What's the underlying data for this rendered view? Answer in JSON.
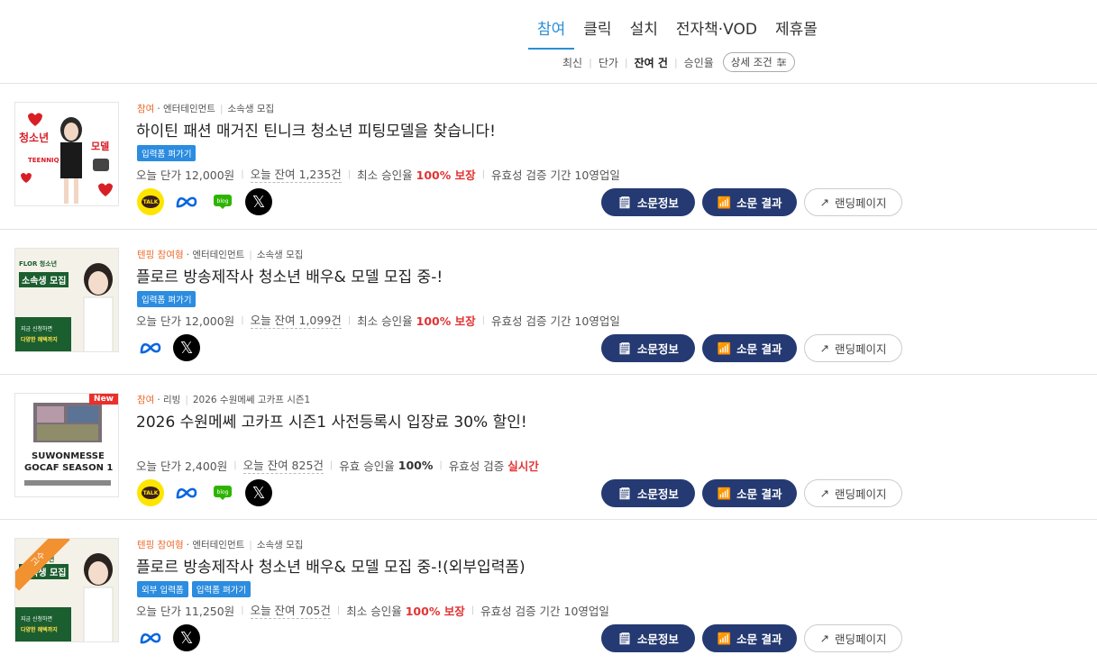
{
  "tabs": [
    {
      "label": "참여",
      "active": true
    },
    {
      "label": "클릭",
      "active": false
    },
    {
      "label": "설치",
      "active": false
    },
    {
      "label": "전자책·VOD",
      "active": false
    },
    {
      "label": "제휴몰",
      "active": false
    }
  ],
  "sorts": [
    {
      "label": "최신",
      "active": false
    },
    {
      "label": "단가",
      "active": false
    },
    {
      "label": "잔여 건",
      "active": true
    },
    {
      "label": "승인율",
      "active": false
    }
  ],
  "detail_filter_label": "상세 조건",
  "buttons": {
    "info": "소문정보",
    "result": "소문 결과",
    "landing": "랜딩페이지"
  },
  "colors": {
    "accent": "#2a8fd6",
    "navy": "#253a72",
    "highlight": "#e23434",
    "category": "#ec6a2a",
    "badge": "#2b8ce0"
  },
  "items": [
    {
      "meta": {
        "category": "참여",
        "sub": "· 엔터테인먼트",
        "tag": "소속생 모집"
      },
      "title": "하이틴 패션 매거진 틴니크 청소년 피팅모델을 찾습니다!",
      "badges": [
        "입력폼 펴가기"
      ],
      "price": "오늘 단가 12,000원",
      "remaining": "오늘 잔여 1,235건",
      "rate_label": "최소 승인율",
      "rate_value": "100% 보장",
      "valid": "유효성 검증 기간 10영업일",
      "socials": [
        "kakao-talk",
        "meta",
        "naver-blog",
        "x"
      ],
      "thumb_text": [
        "청소년",
        "모델",
        "TEENNIQ"
      ]
    },
    {
      "meta": {
        "category": "텐핑 참여형",
        "sub": "· 엔터테인먼트",
        "tag": "소속생 모집"
      },
      "title": "플로르 방송제작사 청소년 배우& 모델 모집 중-!",
      "badges": [
        "입력폼 펴가기"
      ],
      "price": "오늘 단가 12,000원",
      "remaining": "오늘 잔여 1,099건",
      "rate_label": "최소 승인율",
      "rate_value": "100% 보장",
      "valid": "유효성 검증 기간 10영업일",
      "socials": [
        "meta",
        "x"
      ],
      "thumb_text": [
        "FLOR 청소년",
        "소속생 모집",
        "지금 신청하면",
        "다양한 혜택까지"
      ]
    },
    {
      "meta": {
        "category": "참여",
        "sub": "· 리빙",
        "tag": "2026 수원메쎄 고카프 시즌1"
      },
      "title": "2026 수원메쎄 고카프 시즌1 사전등록시 입장료 30% 할인!",
      "badges": [],
      "price": "오늘 단가 2,400원",
      "remaining": "오늘 잔여 825건",
      "rate_label": "유효 승인율",
      "rate_value": "100%",
      "valid_label": "유효성 검증",
      "valid_value": "실시간",
      "socials": [
        "kakao-talk",
        "meta",
        "naver-blog",
        "x"
      ],
      "thumb_text": [
        "SUWONMESSE",
        "GOCAF SEASON 1"
      ],
      "new_tag": "New"
    },
    {
      "meta": {
        "category": "텐핑 참여형",
        "sub": "· 엔터테인먼트",
        "tag": "소속생 모집"
      },
      "title": "플로르 방송제작사 청소년 배우& 모델 모집 중-!(외부입력폼)",
      "badges": [
        "외부 입력폼",
        "입력폼 펴가기"
      ],
      "price": "오늘 단가 11,250원",
      "remaining": "오늘 잔여 705건",
      "rate_label": "최소 승인율",
      "rate_value": "100% 보장",
      "valid": "유효성 검증 기간 10영업일",
      "socials": [
        "meta",
        "x"
      ],
      "thumb_text": [
        "청소년",
        "소속생 모집",
        "지금 신청하면",
        "다양한 혜택까지"
      ],
      "ribbon": "고수"
    }
  ],
  "social_labels": {
    "kakao": "TALK",
    "blog": "blog"
  }
}
